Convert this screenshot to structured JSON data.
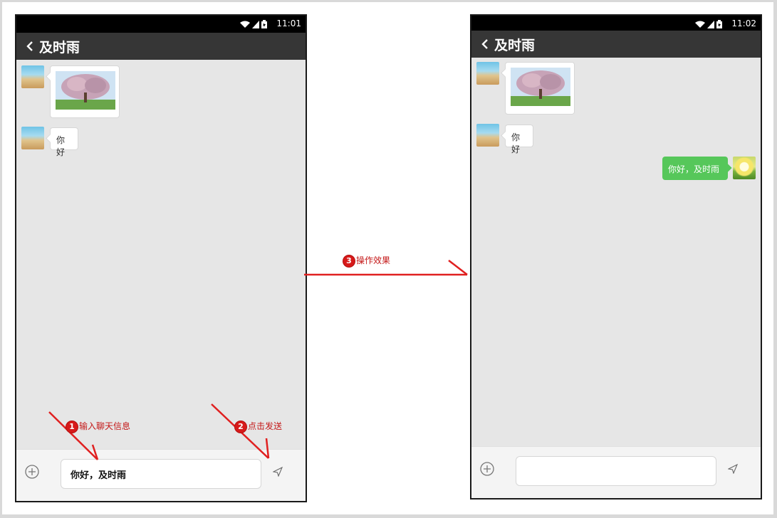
{
  "phone_before": {
    "status_time": "11:01",
    "title": "及时雨",
    "messages": [
      {
        "type": "image",
        "side": "left"
      },
      {
        "type": "text",
        "side": "left",
        "text": "你好"
      }
    ],
    "input_value": "你好，及时雨"
  },
  "phone_after": {
    "status_time": "11:02",
    "title": "及时雨",
    "messages": [
      {
        "type": "image",
        "side": "left"
      },
      {
        "type": "text",
        "side": "left",
        "text": "你好"
      },
      {
        "type": "text",
        "side": "right",
        "text": "你好，及时雨"
      }
    ],
    "input_value": ""
  },
  "annotations": {
    "step1": {
      "number": "1",
      "label": "输入聊天信息"
    },
    "step2": {
      "number": "2",
      "label": "点击发送"
    },
    "step3": {
      "number": "3",
      "label": "操作效果"
    }
  },
  "colors": {
    "status_bar": "#000000",
    "title_bar": "#363636",
    "chat_bg": "#e6e6e6",
    "sent_bubble": "#56c75a",
    "annotation": "#d71a1a"
  },
  "icons": [
    "back-icon",
    "wifi-icon",
    "signal-icon",
    "battery-icon",
    "plus-icon",
    "send-icon"
  ]
}
